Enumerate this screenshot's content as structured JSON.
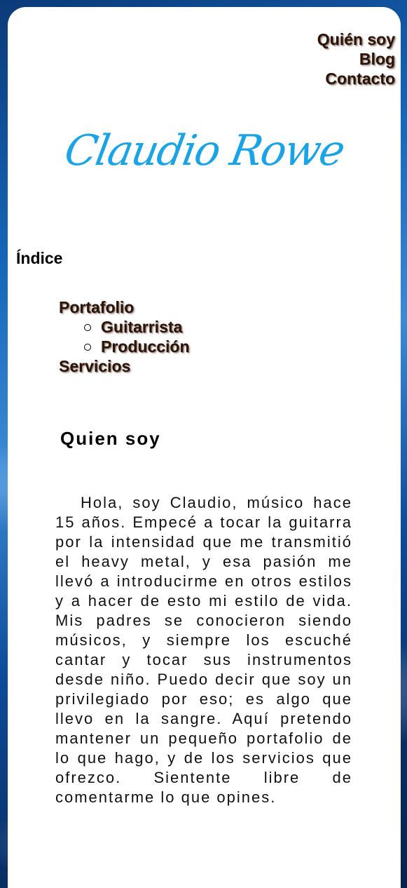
{
  "nav": {
    "items": [
      {
        "label": "Quién soy"
      },
      {
        "label": "Blog"
      },
      {
        "label": "Contacto"
      }
    ]
  },
  "logo": {
    "text": "Claudio Rowe",
    "color": "#18a4e6"
  },
  "index": {
    "title": "Índice",
    "portafolio": "Portafolio",
    "guitarrista": "Guitarrista",
    "produccion": "Producción",
    "servicios": "Servicios"
  },
  "about": {
    "title": "Quien soy",
    "body": "Hola, soy Claudio, músico hace 15 años. Empecé a tocar la guitarra por la intensidad que me transmitió el heavy metal, y esa pasión me llevó a introducirme en otros estilos y a hacer de esto mi estilo de vida. Mis padres se conocieron siendo músicos, y siempre los escuché cantar y tocar sus instrumentos desde niño. Puedo decir que soy un privilegiado por eso; es algo que llevo en la sangre. Aquí pretendo mantener un pequeño portafolio de lo que hago, y de los servicios que ofrezco. Sientente libre de comentarme lo que opines."
  }
}
